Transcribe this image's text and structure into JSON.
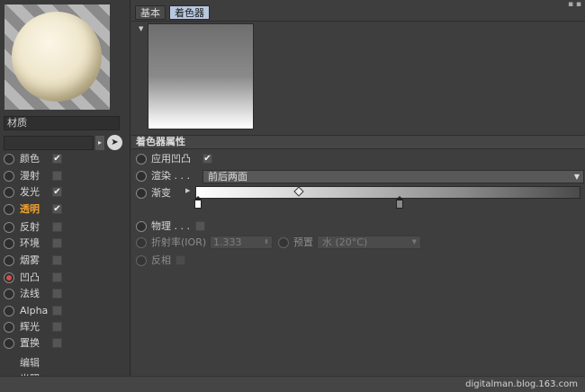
{
  "left_panel": {
    "material_title": "材质",
    "channels": [
      {
        "label": "颜色",
        "checked": true
      },
      {
        "label": "漫射",
        "checked": false
      },
      {
        "label": "发光",
        "checked": true
      },
      {
        "label": "透明",
        "checked": true,
        "highlight": true
      },
      {
        "label": "反射",
        "checked": false
      },
      {
        "label": "环境",
        "checked": false
      },
      {
        "label": "烟雾",
        "checked": false
      },
      {
        "label": "凹凸",
        "checked": false,
        "active": true
      },
      {
        "label": "法线",
        "checked": false
      },
      {
        "label": "Alpha",
        "checked": false
      },
      {
        "label": "辉光",
        "checked": false
      },
      {
        "label": "置换",
        "checked": false
      }
    ],
    "sub_items": [
      "编辑",
      "光照"
    ],
    "check_glyph": "✔"
  },
  "tabs": [
    {
      "label": "基本",
      "active": false
    },
    {
      "label": "着色器",
      "active": true
    }
  ],
  "shader": {
    "section_title": "着色器属性",
    "apply_bump_label": "应用凹凸",
    "render_label": "渲染 . . .",
    "render_value": "前后两面",
    "gradient_label": "渐变",
    "physical_label": "物理 . . .",
    "ior_label": "折射率(IOR)",
    "ior_value": "1.333",
    "preset_label": "预置",
    "preset_value": "水 (20°C)",
    "invert_label": "反相"
  },
  "colors": {
    "accent_highlight": "#f0a030",
    "active_tab": "#b8c8e0",
    "active_channel": "#d84c4c"
  },
  "watermark": "digitalman.blog.163.com"
}
